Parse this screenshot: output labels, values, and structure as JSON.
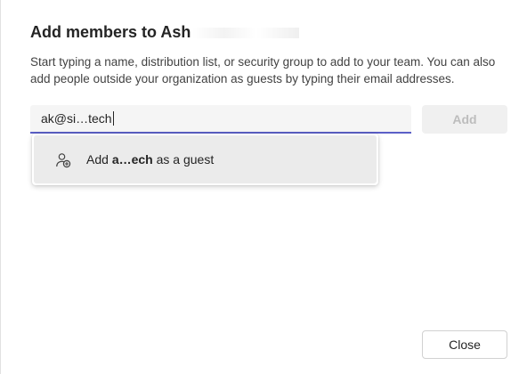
{
  "dialog": {
    "title": "Add members to Ash",
    "description": "Start typing a name, distribution list, or security group to add to your team. You can also add people outside your organization as guests by typing their email addresses."
  },
  "search": {
    "value": "ak@si…tech"
  },
  "buttons": {
    "add_label": "Add",
    "close_label": "Close"
  },
  "suggestion": {
    "prefix": "Add ",
    "name": "a…ech",
    "suffix": " as a guest",
    "icon": "add-guest-icon"
  },
  "colors": {
    "accent": "#5b5fc7",
    "disabled_button_bg": "#f0f0f0",
    "disabled_button_text": "#bdbdbd",
    "highlight": "#ebebeb"
  }
}
